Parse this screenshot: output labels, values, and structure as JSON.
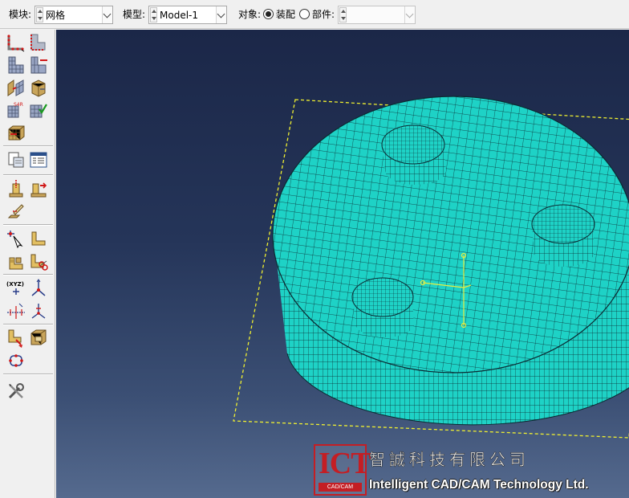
{
  "context_bar": {
    "module_label": "模块:",
    "module_value": "网格",
    "model_label": "模型:",
    "model_value": "Model-1",
    "object_label": "对象:",
    "option_assembly": "装配",
    "option_part": "部件:",
    "object_selected": "assembly",
    "part_value": ""
  },
  "toolbox": {
    "groups": [
      [
        "seed-part-tool",
        "seed-edges-tool",
        "mesh-controls-tool",
        "element-type-tool",
        "mesh-part-tool",
        "delete-mesh-tool",
        "verify-mesh-tool",
        "mesh-region-tool",
        "assign-stack-tool",
        "check-mesh-tool",
        "extrude-mesh-tool"
      ],
      [
        "query-tool",
        "mesh-display-tool"
      ],
      [
        "partition-face-tool",
        "partition-cell-tool",
        "virtual-topology-tool"
      ],
      [
        "datum-edit-tool",
        "datum-point-tool",
        "split-tool",
        "create-element-tool",
        "node-label-tool"
      ],
      [
        "datum-xyz-tool",
        "datum-axis-tool",
        "datum-plane-tool",
        "datum-csys-tool"
      ],
      [
        "edit-mesh-tool",
        "repair-mesh-tool",
        "feature-manager-tool"
      ],
      [
        "toolbox-tools-icon"
      ]
    ]
  },
  "viewport": {
    "mesh_color": "#1ed2c6",
    "mesh_line_color": "#0b2a32",
    "selection_box_color": "#f0f030"
  },
  "watermark": {
    "logo_text": "ICT",
    "logo_subtext": "CAD/CAM",
    "company_cn": "智誠科技有限公司",
    "company_en": "Intelligent CAD/CAM Technology Ltd."
  }
}
